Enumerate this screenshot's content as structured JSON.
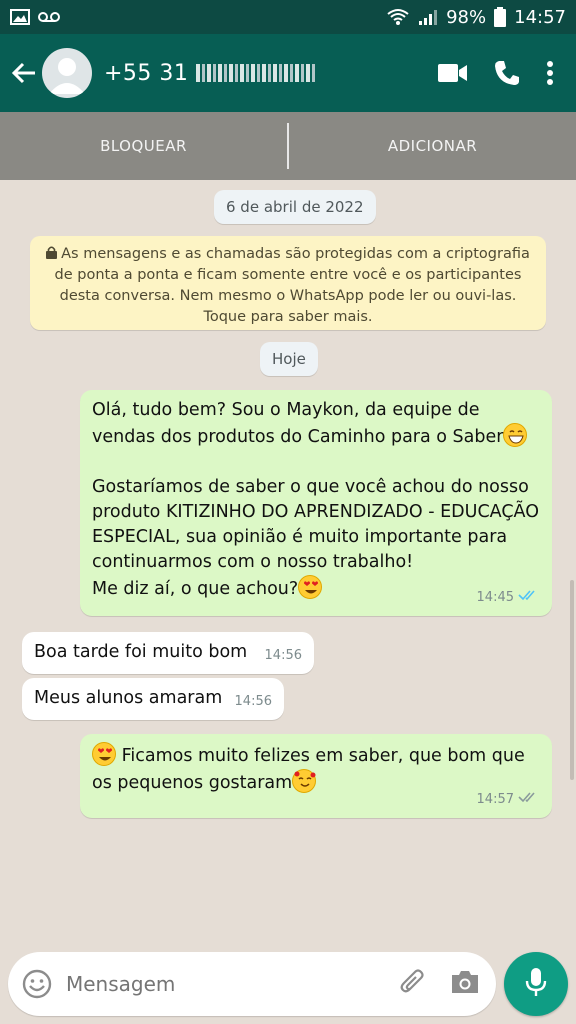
{
  "status_bar": {
    "battery": "98%",
    "time": "14:57"
  },
  "header": {
    "contact_prefix": "+55 31",
    "icons": [
      "back-arrow-icon",
      "avatar",
      "video-call-icon",
      "phone-icon",
      "more-vert-icon"
    ]
  },
  "action_bar": {
    "block_label": "BLOQUEAR",
    "add_label": "ADICIONAR"
  },
  "chat": {
    "date_chip_1": "6 de abril de 2022",
    "encryption_notice": "As mensagens e as chamadas são protegidas com a criptografia de ponta a ponta e ficam somente entre você e os participantes desta conversa. Nem mesmo o WhatsApp pode ler ou ouvi-las. Toque para saber mais.",
    "date_chip_2": "Hoje",
    "messages": [
      {
        "direction": "out",
        "text_1": "Olá, tudo bem? Sou o Maykon, da equipe de vendas dos produtos do Caminho para o Saber",
        "text_2": "Gostaríamos de saber o que você achou do nosso produto KITIZINHO DO APRENDIZADO - EDUCAÇÃO ESPECIAL, sua opinião é muito importante para continuarmos com o nosso trabalho!",
        "text_3": "Me diz aí, o que achou?",
        "time": "14:45",
        "status": "read"
      },
      {
        "direction": "in",
        "text": "Boa tarde foi muito bom",
        "time": "14:56"
      },
      {
        "direction": "in",
        "text": "Meus alunos amaram",
        "time": "14:56"
      },
      {
        "direction": "out",
        "text": "Ficamos muito felizes em saber, que bom que os pequenos gostaram",
        "time": "14:57",
        "status": "delivered"
      }
    ]
  },
  "input": {
    "placeholder": "Mensagem"
  },
  "colors": {
    "header": "#075e54",
    "status_bar": "#0d4a43",
    "chat_bg": "#e5ddd5",
    "outgoing": "#dcf8c6",
    "incoming": "#ffffff",
    "read_tick": "#4fc3f7",
    "fab": "#0f9d84"
  }
}
